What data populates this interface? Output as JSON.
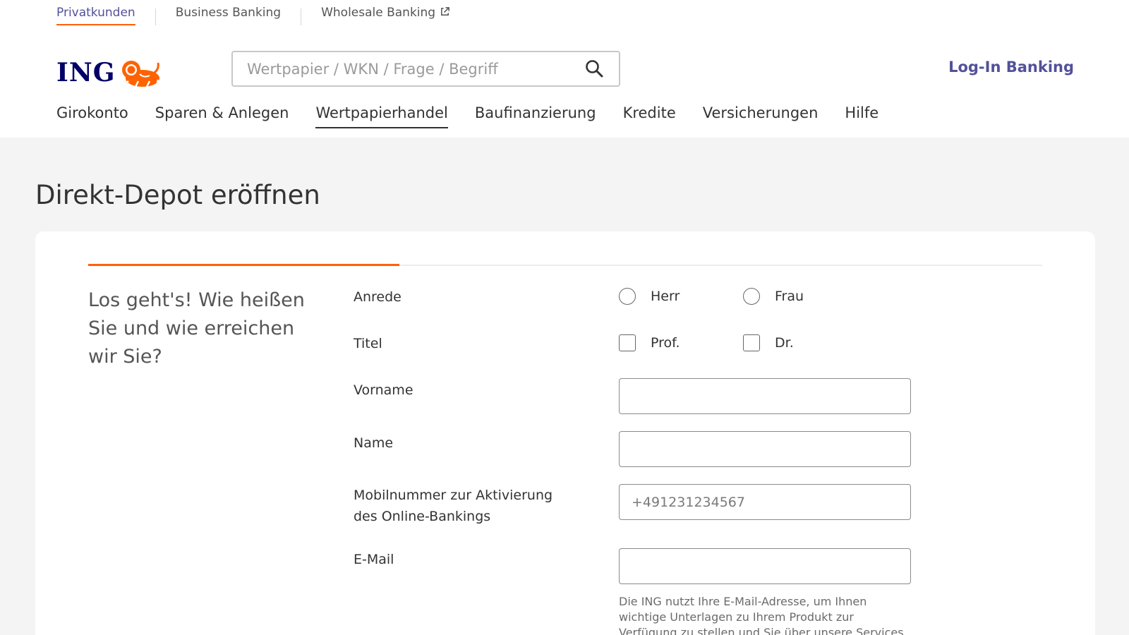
{
  "segments": {
    "items": [
      {
        "label": "Privatkunden"
      },
      {
        "label": "Business Banking"
      },
      {
        "label": "Wholesale Banking"
      }
    ]
  },
  "logo": {
    "text": "ING"
  },
  "search": {
    "placeholder": "Wertpapier / WKN / Frage / Begriff",
    "value": ""
  },
  "login": {
    "label": "Log-In Banking"
  },
  "mainnav": {
    "items": [
      {
        "label": "Girokonto"
      },
      {
        "label": "Sparen & Anlegen"
      },
      {
        "label": "Wertpapierhandel"
      },
      {
        "label": "Baufinanzierung"
      },
      {
        "label": "Kredite"
      },
      {
        "label": "Versicherungen"
      },
      {
        "label": "Hilfe"
      }
    ],
    "active": "Wertpapierhandel"
  },
  "page": {
    "title": "Direkt-Depot eröffnen"
  },
  "progress": {
    "fraction": 0.326
  },
  "intro": {
    "text": "Los geht's! Wie hei­ßen Sie und wie errei­chen wir Sie?"
  },
  "form": {
    "anrede": {
      "label": "Anrede",
      "options": [
        "Herr",
        "Frau"
      ]
    },
    "titel": {
      "label": "Titel",
      "options": [
        "Prof.",
        "Dr."
      ]
    },
    "vorname": {
      "label": "Vorname",
      "value": "",
      "placeholder": ""
    },
    "name": {
      "label": "Name",
      "value": "",
      "placeholder": ""
    },
    "mobil": {
      "label_line1": "Mobilnummer zur Aktivierung",
      "label_line2": "des Online-Bankings",
      "value": "",
      "placeholder": "+491231234567"
    },
    "email": {
      "label": "E-Mail",
      "value": "",
      "placeholder": "",
      "hint": "Die ING nutzt Ihre E-Mail-Adresse, um Ihnen wichtige Unterlagen zu Ihrem Produkt zur Verfügung zu stellen und Sie über unsere Services zu informieren."
    }
  },
  "colors": {
    "brand_orange": "#ff6200",
    "brand_navy": "#000066",
    "link_purple": "#525199"
  }
}
